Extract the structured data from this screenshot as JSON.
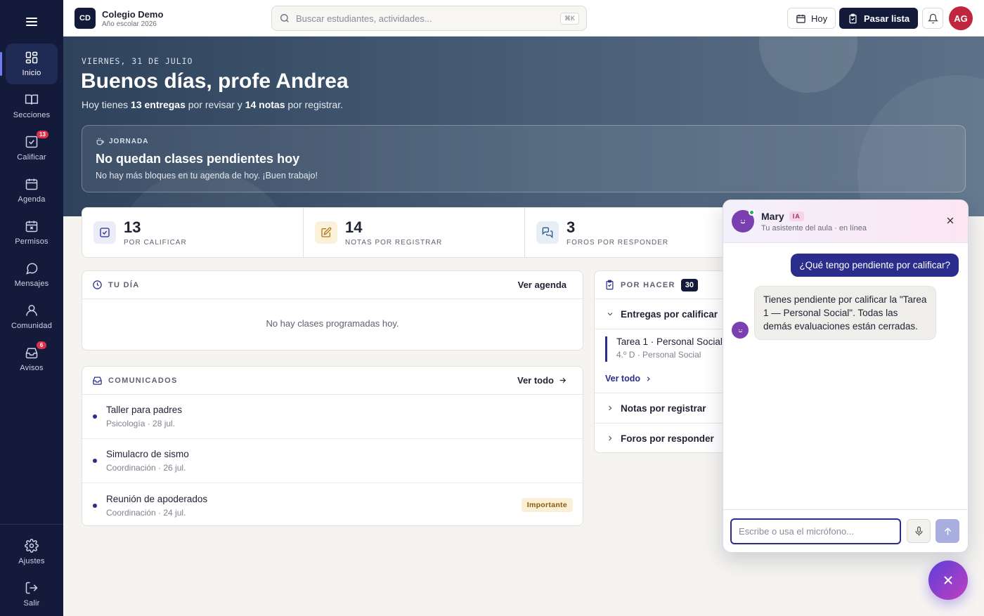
{
  "sidebar": {
    "items": [
      {
        "label": "Inicio",
        "icon": "dashboard-icon",
        "active": true
      },
      {
        "label": "Secciones",
        "icon": "book-icon"
      },
      {
        "label": "Calificar",
        "icon": "grade-icon",
        "badge": "13"
      },
      {
        "label": "Agenda",
        "icon": "calendar-icon"
      },
      {
        "label": "Permisos",
        "icon": "calendar-x-icon"
      },
      {
        "label": "Mensajes",
        "icon": "chat-icon"
      },
      {
        "label": "Comunidad",
        "icon": "user-icon"
      },
      {
        "label": "Avisos",
        "icon": "inbox-icon",
        "badge": "6"
      }
    ],
    "bottom": [
      {
        "label": "Ajustes",
        "icon": "gear-icon"
      },
      {
        "label": "Salir",
        "icon": "logout-icon"
      }
    ]
  },
  "topbar": {
    "logo": "CD",
    "school": "Colegio Demo",
    "year": "Año escolar 2026",
    "search_placeholder": "Buscar estudiantes, actividades...",
    "search_shortcut": "⌘K",
    "today_label": "Hoy",
    "attendance_label": "Pasar lista",
    "avatar": "AG"
  },
  "hero": {
    "date": "VIERNES, 31 DE JULIO",
    "greeting": "Buenos días, profe Andrea",
    "sub_pre": "Hoy tienes",
    "sub_b1": "13 entregas",
    "sub_mid": "por revisar y",
    "sub_b2": "14 notas",
    "sub_post": "por registrar.",
    "card_tag": "JORNADA",
    "card_title": "No quedan clases pendientes hoy",
    "card_sub": "No hay más bloques en tu agenda de hoy. ¡Buen trabajo!"
  },
  "stats": [
    {
      "value": "13",
      "label": "POR CALIFICAR",
      "color": "#2a2d8c",
      "bg": "#ecebf8"
    },
    {
      "value": "14",
      "label": "NOTAS POR REGISTRAR",
      "color": "#b4781a",
      "bg": "#fbf0d9"
    },
    {
      "value": "3",
      "label": "FOROS POR RESPONDER",
      "color": "#2e5b86",
      "bg": "#e6eef6"
    }
  ],
  "tu_dia": {
    "title": "TU DÍA",
    "link": "Ver agenda",
    "empty": "No hay clases programadas hoy."
  },
  "comunicados": {
    "title": "COMUNICADOS",
    "link": "Ver todo",
    "items": [
      {
        "title": "Taller para padres",
        "meta": "Psicología · 28 jul."
      },
      {
        "title": "Simulacro de sismo",
        "meta": "Coordinación · 26 jul."
      },
      {
        "title": "Reunión de apoderados",
        "meta": "Coordinación · 24 jul.",
        "tag": "Importante"
      }
    ]
  },
  "por_hacer": {
    "title": "POR HACER",
    "count": "30",
    "sections": [
      {
        "label": "Entregas por calificar",
        "expanded": true
      },
      {
        "label": "Notas por registrar"
      },
      {
        "label": "Foros por responder"
      }
    ],
    "task_title": "Tarea 1 · Personal Social",
    "task_meta": "4.º D · Personal Social",
    "link": "Ver todo"
  },
  "chat": {
    "name": "Mary",
    "ai_badge": "IA",
    "status": "Tu asistente del aula · en línea",
    "user_msg": "¿Qué tengo pendiente por calificar?",
    "bot_msg": "Tienes pendiente por calificar la \"Tarea 1 — Personal Social\". Todas las demás evaluaciones están cerradas.",
    "input_placeholder": "Escribe o usa el micrófono..."
  },
  "colors": {
    "sidebar": "#141b3a",
    "accent": "#2a2d8c",
    "danger": "#e0304a"
  }
}
